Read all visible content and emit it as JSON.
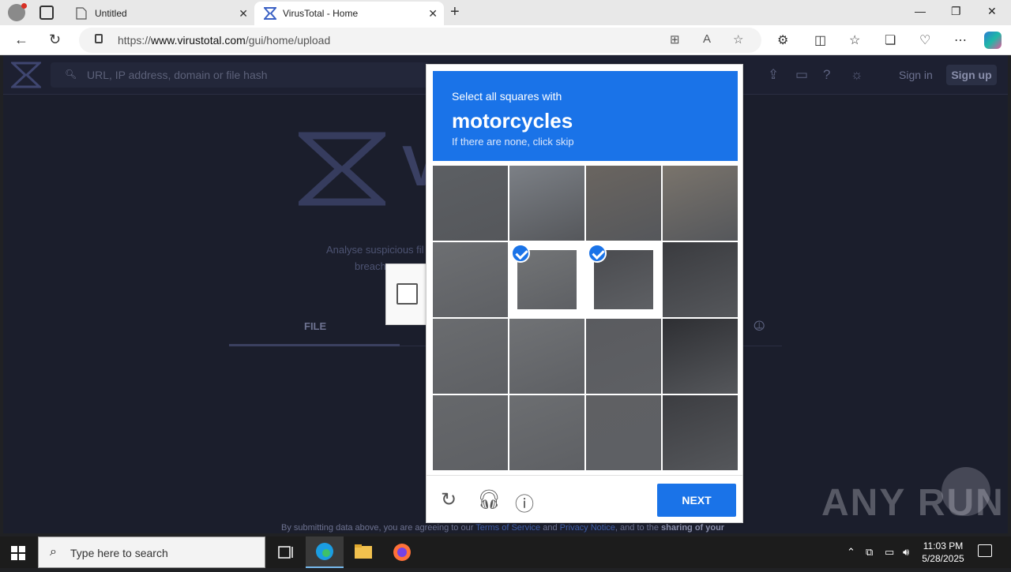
{
  "browser": {
    "tabs": [
      {
        "title": "Untitled",
        "active": false
      },
      {
        "title": "VirusTotal - Home",
        "active": true
      }
    ],
    "url_prefix": "https://",
    "url_domain": "www.virustotal.com",
    "url_path": "/gui/home/upload",
    "icons": {
      "back": "back-icon",
      "refresh": "refresh-icon",
      "new_tab": "plus-icon"
    }
  },
  "virustotal": {
    "search_placeholder": "URL, IP address, domain or file hash",
    "sign_in": "Sign in",
    "sign_up": "Sign up",
    "logo_letter": "V",
    "tagline_line1": "Analyse suspicious fil",
    "tagline_line2": "breach",
    "tab_file": "FILE",
    "footer": {
      "part1": "By submitting data above, you are agreeing to our ",
      "terms": "Terms of Service",
      "part2": " and ",
      "privacy": "Privacy Notice",
      "part3": ", and to the ",
      "bold": "sharing of your"
    }
  },
  "captcha": {
    "instruction": "Select all squares with",
    "keyword": "motorcycles",
    "hint": "If there are none, click skip",
    "next_label": "NEXT",
    "selected_tiles": [
      5,
      6
    ],
    "colors": {
      "accent": "#1a73e8"
    }
  },
  "watermark": {
    "text": "ANY RUN"
  },
  "taskbar": {
    "search_placeholder": "Type here to search",
    "time": "11:03 PM",
    "date": "5/28/2025"
  }
}
